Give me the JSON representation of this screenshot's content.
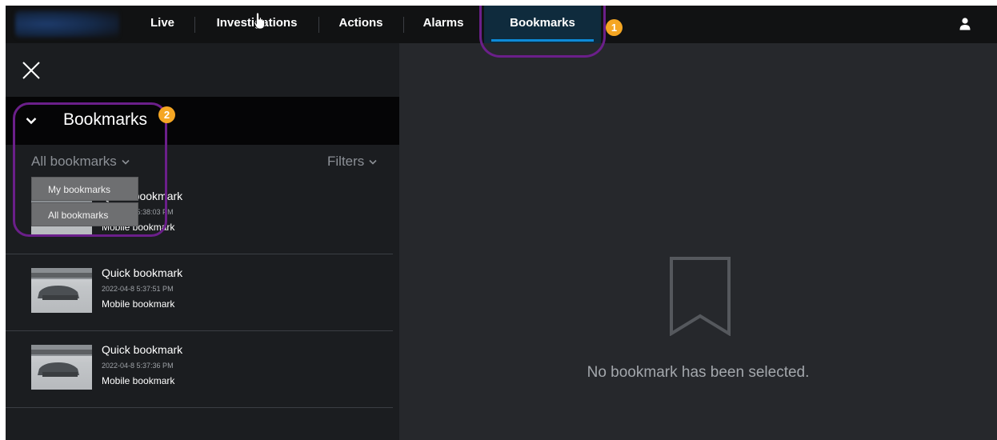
{
  "nav": {
    "items": [
      "Live",
      "Investigations",
      "Actions",
      "Alarms",
      "Bookmarks"
    ],
    "active": "Bookmarks",
    "accent_color": "#0d8ad8"
  },
  "callouts": {
    "badge_1": "1",
    "badge_2": "2",
    "badge_color": "#f5a623",
    "outline_color": "#6b1f8a"
  },
  "panel": {
    "section_title": "Bookmarks",
    "scope_select": "All bookmarks",
    "filters_label": "Filters",
    "dropdown_options": [
      "My bookmarks",
      "All bookmarks"
    ]
  },
  "bookmarks": [
    {
      "title": "Quick bookmark",
      "time": "2022-04-8 5:38:03 PM",
      "note": "Mobile bookmark"
    },
    {
      "title": "Quick bookmark",
      "time": "2022-04-8 5:37:51 PM",
      "note": "Mobile bookmark"
    },
    {
      "title": "Quick bookmark",
      "time": "2022-04-8 5:37:36 PM",
      "note": "Mobile bookmark"
    }
  ],
  "detail": {
    "empty_text": "No bookmark has been selected.",
    "icon": "bookmark-outline-icon"
  }
}
